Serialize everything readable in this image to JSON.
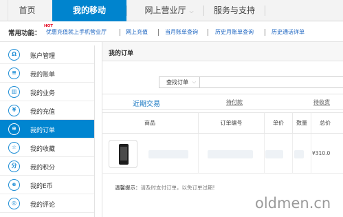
{
  "topnav": {
    "tabs": [
      {
        "label": "首页"
      },
      {
        "label": "我的移动"
      },
      {
        "label": "网上营业厅"
      },
      {
        "label": "服务与支持"
      }
    ],
    "active_color": "#0084ce"
  },
  "quick": {
    "label": "常用功能：",
    "hot_badge": "HOT",
    "links": [
      "优惠充值就上手机营业厅",
      "网上充值",
      "当月账单查询",
      "历史月账单查询",
      "历史通话详单"
    ]
  },
  "sidebar": {
    "items": [
      {
        "label": "账户管理",
        "icon": "user-icon",
        "glyph": "Ω"
      },
      {
        "label": "我的账单",
        "icon": "bill-icon",
        "glyph": "≡"
      },
      {
        "label": "我的业务",
        "icon": "service-icon",
        "glyph": "▥"
      },
      {
        "label": "我的充值",
        "icon": "yuan-icon",
        "glyph": "¥"
      },
      {
        "label": "我的订单",
        "icon": "order-icon",
        "glyph": "⊕"
      },
      {
        "label": "我的收藏",
        "icon": "star-icon",
        "glyph": "☆"
      },
      {
        "label": "我的积分",
        "icon": "points-icon",
        "glyph": "分"
      },
      {
        "label": "我的E币",
        "icon": "ecoin-icon",
        "glyph": "e"
      },
      {
        "label": "我的评论",
        "icon": "comment-icon",
        "glyph": "◎"
      }
    ],
    "active_index": 4,
    "active_color": "#0085d0"
  },
  "main": {
    "title": "我的订单",
    "search": {
      "select_label": "查找订单"
    },
    "filter_tabs": [
      "近期交易",
      "待付款",
      "待收货"
    ],
    "table": {
      "headers": [
        "商品",
        "订单编号",
        "单价",
        "数量",
        "总价"
      ]
    },
    "row": {
      "price": "¥310.0"
    },
    "tip_label": "温馨提示：",
    "tip_text": "请及时支付订单，以免订单过期!"
  },
  "watermark": "oldmen.cn"
}
